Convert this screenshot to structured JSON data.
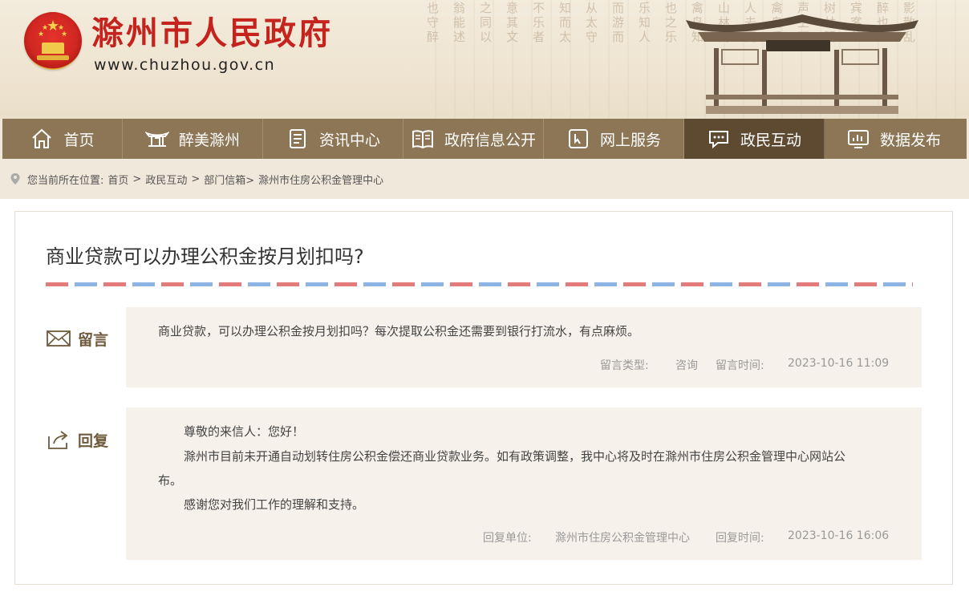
{
  "header": {
    "site_title": "滁州市人民政府",
    "site_url": "www.chuzhou.gov.cn",
    "poem_columns": [
      "也守醉",
      "翁能述",
      "之同以",
      "意其文",
      "不乐者",
      "知而太",
      "从太守",
      "而游而",
      "乐知人",
      "也之乐",
      "禽鸟知",
      "山林而",
      "人去而",
      "禽鸟乐",
      "声上下",
      "树林阴",
      "宾客从",
      "醉也",
      "影散乱"
    ]
  },
  "nav": {
    "items": [
      {
        "label": "首页",
        "icon": "home-icon"
      },
      {
        "label": "醉美滁州",
        "icon": "pavilion-icon"
      },
      {
        "label": "资讯中心",
        "icon": "news-icon"
      },
      {
        "label": "政府信息公开",
        "icon": "book-icon"
      },
      {
        "label": "网上服务",
        "icon": "service-icon"
      },
      {
        "label": "政民互动",
        "icon": "chat-icon"
      },
      {
        "label": "数据发布",
        "icon": "chart-icon"
      }
    ],
    "active_index": 5
  },
  "breadcrumb": {
    "prefix": "您当前所在位置:",
    "items": [
      "首页",
      ">",
      "政民互动",
      ">",
      "部门信箱>",
      "滁州市住房公积金管理中心"
    ]
  },
  "question": {
    "title": "商业贷款可以办理公积金按月划扣吗?",
    "label": "留言",
    "content": "商业贷款，可以办理公积金按月划扣吗？每次提取公积金还需要到银行打流水，有点麻烦。",
    "type_label": "留言类型:",
    "type_value": "咨询",
    "time_label": "留言时间:",
    "time_value": "2023-10-16 11:09"
  },
  "reply": {
    "label": "回复",
    "greeting": "尊敬的来信人：您好！",
    "body_line1": "滁州市目前未开通自动划转住房公积金偿还商业贷款业务。如有政策调整，我中心将及时在滁州市住房公积金管理中心网站公",
    "body_line2": "布。",
    "thanks": "感谢您对我们工作的理解和支持。",
    "unit_label": "回复单位:",
    "unit_value": "滁州市住房公积金管理中心",
    "time_label": "回复时间:",
    "time_value": "2023-10-16 16:06"
  },
  "colors": {
    "brand_red": "#c4241d",
    "nav_bg": "#8d7655",
    "nav_active": "#5e4a31",
    "airmail_red": "#e47b7b",
    "airmail_blue": "#8eb4e6"
  }
}
